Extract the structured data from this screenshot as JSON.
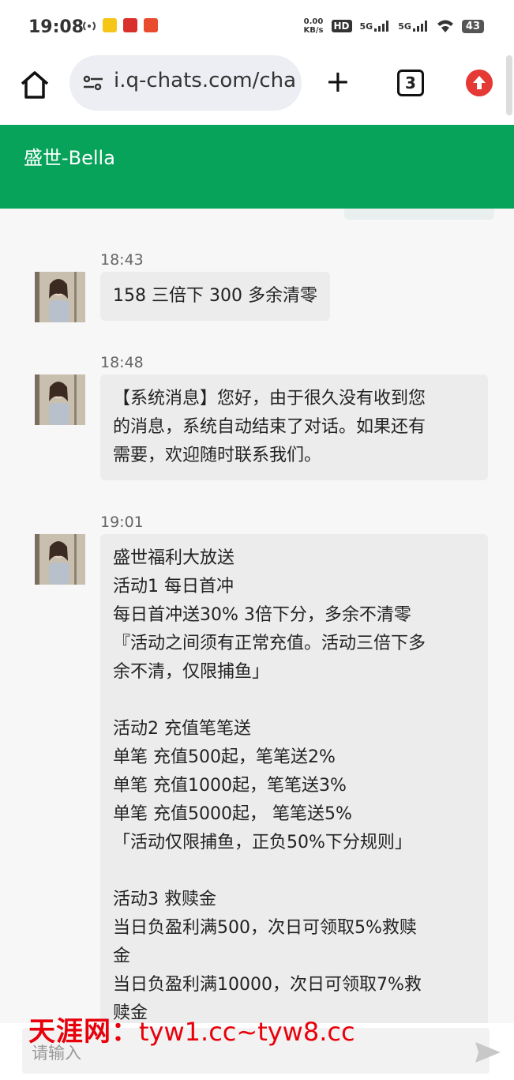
{
  "status_bar": {
    "time": "19:08",
    "net_speed": "0.00\nKB/s",
    "hd_label": "HD",
    "signal1": "5G",
    "signal2": "5G",
    "battery": "43"
  },
  "browser": {
    "url": "i.q-chats.com/cha",
    "tab_count": "3"
  },
  "chat_header": {
    "title": "盛世-Bella"
  },
  "messages": [
    {
      "time": "18:43",
      "lines": [
        "158 三倍下 300 多余清零"
      ]
    },
    {
      "time": "18:48",
      "lines": [
        "【系统消息】您好，由于很久没有收到您",
        "的消息，系统自动结束了对话。如果还有",
        "需要，欢迎随时联系我们。"
      ]
    },
    {
      "time": "19:01",
      "lines": [
        "盛世福利大放送",
        "活动1 每日首冲",
        "每日首冲送30% 3倍下分，多余不清零",
        "『活动之间须有正常充值。活动三倍下多",
        "余不清，仅限捕鱼」",
        "",
        "活动2 充值笔笔送",
        "单笔 充值500起，笔笔送2%",
        "单笔 充值1000起，笔笔送3%",
        "单笔 充值5000起， 笔笔送5%",
        "「活动仅限捕鱼，正负50%下分规则」",
        "",
        "活动3 救赎金",
        "当日负盈利满500，次日可领取5%救赎",
        "金",
        "当日负盈利满10000，次日可领取7%救",
        "赎金"
      ]
    }
  ],
  "input": {
    "placeholder": "请输入"
  },
  "watermark": {
    "brand": "天涯网：",
    "url": "tyw1.cc~tyw8.cc"
  }
}
